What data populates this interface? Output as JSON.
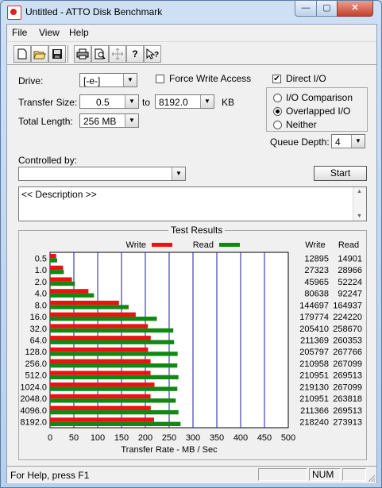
{
  "window": {
    "title": "Untitled - ATTO Disk Benchmark",
    "min_glyph": "—",
    "max_glyph": "▢",
    "close_glyph": "✕"
  },
  "menu": [
    "File",
    "View",
    "Help"
  ],
  "toolbar_icons": [
    "new-icon",
    "open-icon",
    "save-icon",
    "print-icon",
    "print-preview-icon",
    "move-icon",
    "help-icon",
    "context-help-icon"
  ],
  "form": {
    "drive_label": "Drive:",
    "drive_value": "[-e-]",
    "force_write_label": "Force Write Access",
    "force_write_checked": false,
    "direct_io_label": "Direct I/O",
    "direct_io_checked": true,
    "transfer_size_label": "Transfer Size:",
    "transfer_from": "0.5",
    "to_label": "to",
    "transfer_to": "8192.0",
    "kb_label": "KB",
    "total_length_label": "Total Length:",
    "total_length_value": "256 MB",
    "io_modes": [
      {
        "label": "I/O Comparison",
        "selected": false
      },
      {
        "label": "Overlapped I/O",
        "selected": true
      },
      {
        "label": "Neither",
        "selected": false
      }
    ],
    "queue_depth_label": "Queue Depth:",
    "queue_depth_value": "4",
    "controlled_by_label": "Controlled by:",
    "controlled_by_value": "",
    "start_label": "Start",
    "description_text": "<< Description >>"
  },
  "chart_data": {
    "type": "bar",
    "title": "Test Results",
    "orientation": "horizontal",
    "categories": [
      "0.5",
      "1.0",
      "2.0",
      "4.0",
      "8.0",
      "16.0",
      "32.0",
      "64.0",
      "128.0",
      "256.0",
      "512.0",
      "1024.0",
      "2048.0",
      "4096.0",
      "8192.0"
    ],
    "series": [
      {
        "name": "Write",
        "color": "#ee1111",
        "values": [
          12895,
          27323,
          45965,
          80638,
          144697,
          179774,
          205410,
          211369,
          205797,
          210958,
          210951,
          219130,
          210951,
          211366,
          218240
        ]
      },
      {
        "name": "Read",
        "color": "#118811",
        "values": [
          14901,
          28966,
          52224,
          92247,
          164937,
          224220,
          258670,
          260353,
          267766,
          267099,
          269513,
          267099,
          263818,
          269513,
          273913
        ]
      }
    ],
    "column_headers": [
      "Write",
      "Read"
    ],
    "xlabel": "Transfer Rate - MB / Sec",
    "xlim": [
      0,
      500
    ],
    "xticks": [
      0,
      50,
      100,
      150,
      200,
      250,
      300,
      350,
      400,
      450,
      500
    ],
    "grid": true,
    "legend": "top-center"
  },
  "status": {
    "help_text": "For Help, press F1",
    "num_indicator": "NUM"
  }
}
